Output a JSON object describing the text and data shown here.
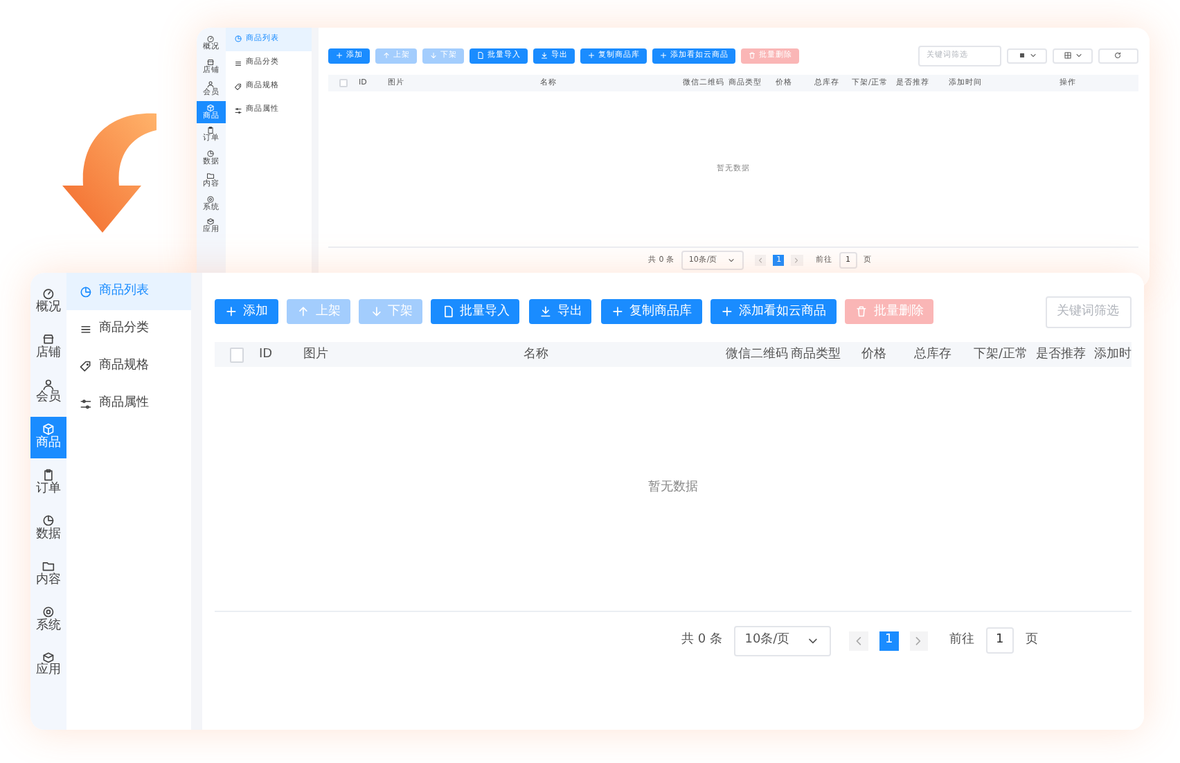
{
  "screens": [
    {
      "nav": [
        {
          "label": "概况",
          "selected": false
        },
        {
          "label": "店铺",
          "selected": false
        },
        {
          "label": "会员",
          "selected": false
        },
        {
          "label": "商品",
          "selected": true
        },
        {
          "label": "订单",
          "selected": false
        },
        {
          "label": "数据",
          "selected": false
        },
        {
          "label": "内容",
          "selected": false
        },
        {
          "label": "系统",
          "selected": false
        },
        {
          "label": "应用",
          "selected": false
        }
      ],
      "submenu": [
        {
          "label": "商品列表",
          "selected": true
        },
        {
          "label": "商品分类",
          "selected": false
        },
        {
          "label": "商品规格",
          "selected": false
        },
        {
          "label": "商品属性",
          "selected": false
        }
      ],
      "toolbar": {
        "buttons": [
          {
            "label": "添加",
            "kind": "primary",
            "disabled": false
          },
          {
            "label": "上架",
            "kind": "primary",
            "disabled": true
          },
          {
            "label": "下架",
            "kind": "primary",
            "disabled": true
          },
          {
            "label": "批量导入",
            "kind": "primary",
            "disabled": false
          },
          {
            "label": "导出",
            "kind": "primary",
            "disabled": false
          },
          {
            "label": "复制商品库",
            "kind": "primary",
            "disabled": false
          },
          {
            "label": "添加看如云商品",
            "kind": "primary",
            "disabled": false
          },
          {
            "label": "批量删除",
            "kind": "danger",
            "disabled": true
          }
        ],
        "search": {
          "placeholder": "关键词筛选"
        },
        "tools": [
          {
            "kind": "density"
          },
          {
            "kind": "columns"
          },
          {
            "kind": "refresh"
          }
        ]
      },
      "table": {
        "select_all": {
          "checked": false
        },
        "columns": [
          "ID",
          "图片",
          "名称",
          "微信二维码",
          "商品类型",
          "价格",
          "总库存",
          "下架/正常",
          "是否推荐",
          "添加时间",
          "操作"
        ],
        "empty_text": "暂无数据"
      },
      "pagination": {
        "total": "共 0 条",
        "page_size": "10条/页",
        "pages": [
          {
            "label": "1",
            "selected": true
          }
        ],
        "goto_label": "前往",
        "goto_value": "1",
        "page_unit": "页"
      }
    },
    {
      "nav": [
        {
          "label": "概况",
          "selected": false
        },
        {
          "label": "店铺",
          "selected": false
        },
        {
          "label": "会员",
          "selected": false
        },
        {
          "label": "商品",
          "selected": true
        },
        {
          "label": "订单",
          "selected": false
        },
        {
          "label": "数据",
          "selected": false
        },
        {
          "label": "内容",
          "selected": false
        },
        {
          "label": "系统",
          "selected": false
        },
        {
          "label": "应用",
          "selected": false
        }
      ],
      "submenu": [
        {
          "label": "商品列表",
          "selected": true
        },
        {
          "label": "商品分类",
          "selected": false
        },
        {
          "label": "商品规格",
          "selected": false
        },
        {
          "label": "商品属性",
          "selected": false
        }
      ],
      "toolbar": {
        "buttons": [
          {
            "label": "添加",
            "kind": "primary",
            "disabled": false
          },
          {
            "label": "上架",
            "kind": "primary",
            "disabled": true
          },
          {
            "label": "下架",
            "kind": "primary",
            "disabled": true
          },
          {
            "label": "批量导入",
            "kind": "primary",
            "disabled": false
          },
          {
            "label": "导出",
            "kind": "primary",
            "disabled": false
          },
          {
            "label": "复制商品库",
            "kind": "primary",
            "disabled": false
          },
          {
            "label": "添加看如云商品",
            "kind": "primary",
            "disabled": false
          },
          {
            "label": "批量删除",
            "kind": "danger",
            "disabled": true
          }
        ],
        "search": {
          "placeholder": "关键词筛选"
        }
      },
      "table": {
        "select_all": {
          "checked": false
        },
        "columns": [
          "ID",
          "图片",
          "名称",
          "微信二维码",
          "商品类型",
          "价格",
          "总库存",
          "下架/正常",
          "是否推荐",
          "添加时"
        ],
        "empty_text": "暂无数据"
      },
      "pagination": {
        "total": "共 0 条",
        "page_size": "10条/页",
        "pages": [
          {
            "label": "1",
            "selected": true
          }
        ],
        "goto_label": "前往",
        "goto_value": "1",
        "page_unit": "页"
      }
    }
  ]
}
